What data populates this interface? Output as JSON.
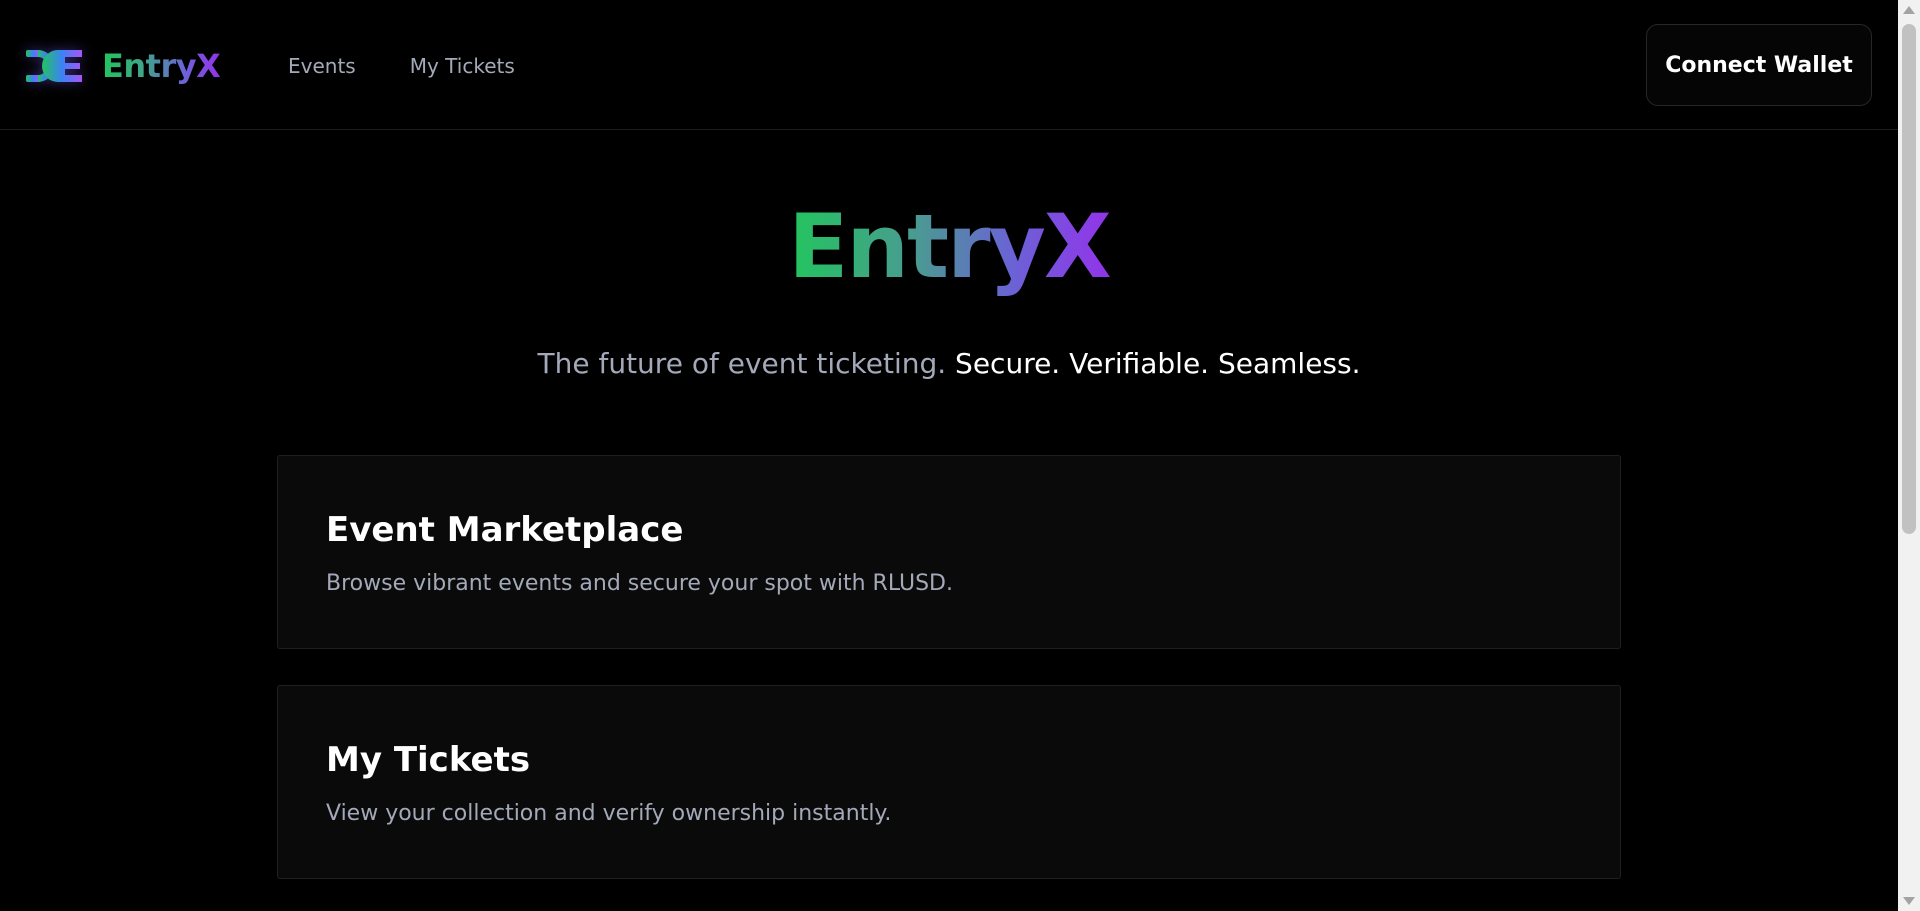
{
  "header": {
    "brand": {
      "logo_icon": "de-monogram-logo-icon",
      "name": "EntryX"
    },
    "nav": [
      {
        "label": "Events"
      },
      {
        "label": "My Tickets"
      }
    ],
    "connect_wallet_label": "Connect Wallet"
  },
  "hero": {
    "title": "EntryX",
    "tagline_muted": "The future of event ticketing.",
    "tagline_bright": "Secure. Verifiable. Seamless."
  },
  "cards": [
    {
      "title": "Event Marketplace",
      "description": "Browse vibrant events and secure your spot with RLUSD."
    },
    {
      "title": "My Tickets",
      "description": "View your collection and verify ownership instantly."
    }
  ],
  "colors": {
    "background": "#000000",
    "card_background": "#0a0a0a",
    "muted_text": "#a3a9b8",
    "gradient_start": "#22c55e",
    "gradient_end": "#9333ea"
  }
}
